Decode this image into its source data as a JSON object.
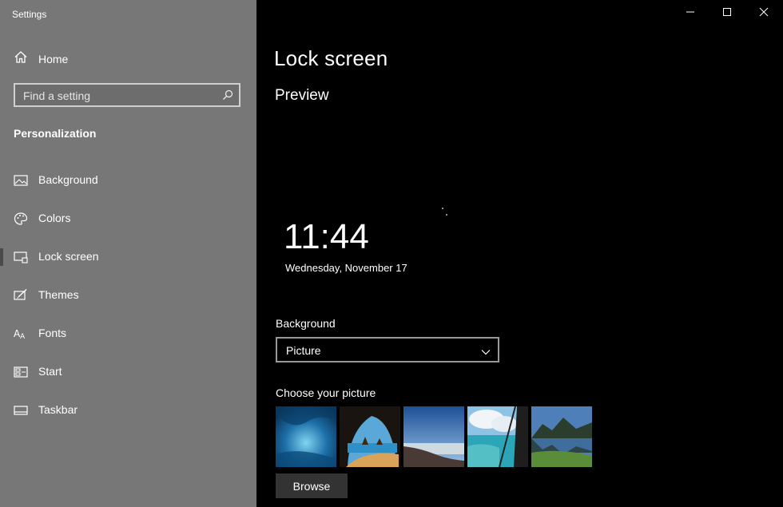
{
  "window": {
    "title": "Settings"
  },
  "sidebar": {
    "home_label": "Home",
    "search_placeholder": "Find a setting",
    "section_title": "Personalization",
    "items": [
      {
        "label": "Background",
        "icon": "picture-icon"
      },
      {
        "label": "Colors",
        "icon": "palette-icon"
      },
      {
        "label": "Lock screen",
        "icon": "lock-screen-icon",
        "selected": true
      },
      {
        "label": "Themes",
        "icon": "themes-icon"
      },
      {
        "label": "Fonts",
        "icon": "fonts-icon"
      },
      {
        "label": "Start",
        "icon": "start-icon"
      },
      {
        "label": "Taskbar",
        "icon": "taskbar-icon"
      }
    ]
  },
  "main": {
    "page_title": "Lock screen",
    "preview_heading": "Preview",
    "clock_time": "11:44",
    "clock_date": "Wednesday, November 17",
    "background_label": "Background",
    "background_value": "Picture",
    "choose_label": "Choose your picture",
    "thumbnails": [
      "ice-cave",
      "sea-arch-beach",
      "desert-sky",
      "cliff-ocean",
      "mountain-lake"
    ],
    "browse_label": "Browse"
  },
  "colors": {
    "sidebar_bg": "#777777",
    "main_bg": "#000000",
    "button_bg": "#333333"
  }
}
